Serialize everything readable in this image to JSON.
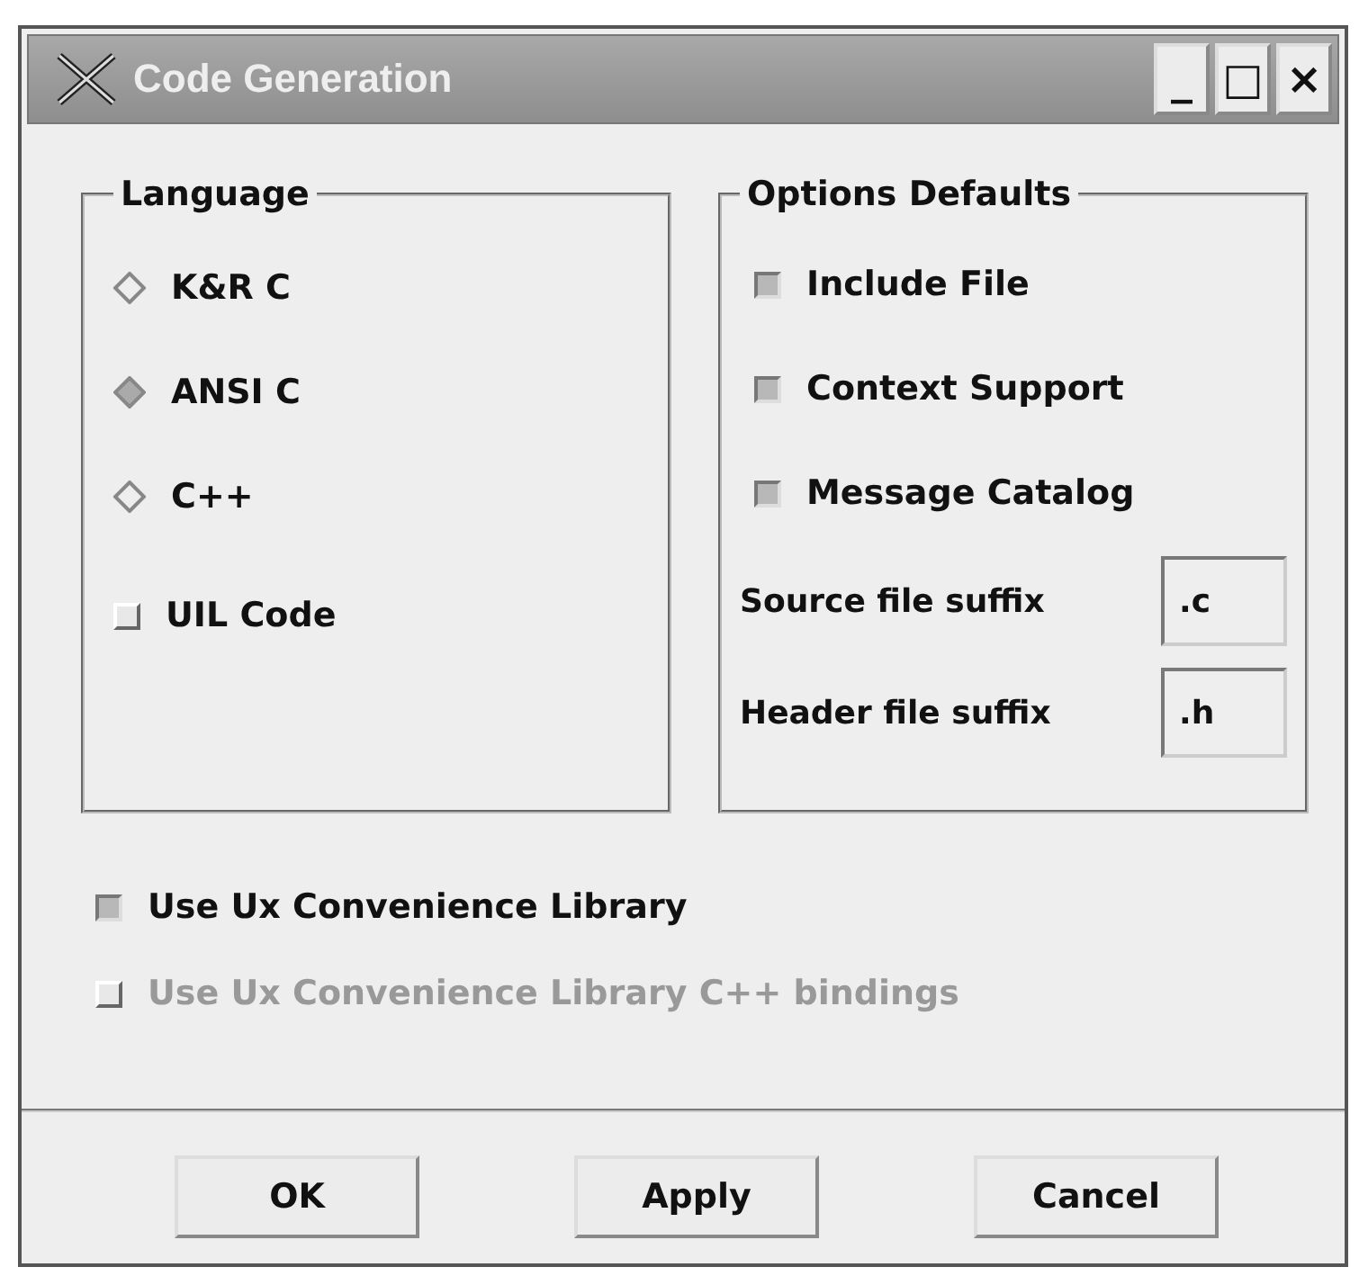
{
  "window": {
    "title": "Code Generation",
    "controls": [
      "_",
      "□",
      "×"
    ]
  },
  "language": {
    "title": "Language",
    "options": [
      {
        "label": "K&R C",
        "kind": "radio",
        "selected": false
      },
      {
        "label": "ANSI C",
        "kind": "radio",
        "selected": true
      },
      {
        "label": "C++",
        "kind": "radio",
        "selected": false
      },
      {
        "label": "UIL Code",
        "kind": "checkbox",
        "checked": false
      }
    ]
  },
  "options_defaults": {
    "title": "Options Defaults",
    "checkboxes": [
      {
        "label": "Include File",
        "checked": true
      },
      {
        "label": "Context Support",
        "checked": true
      },
      {
        "label": "Message Catalog",
        "checked": true
      }
    ],
    "fields": [
      {
        "label": "Source file suffix",
        "value": ".c"
      },
      {
        "label": "Header file suffix",
        "value": ".h"
      }
    ]
  },
  "library_options": [
    {
      "label": "Use Ux Convenience Library",
      "checked": true,
      "disabled": false
    },
    {
      "label": "Use Ux Convenience Library C++ bindings",
      "checked": false,
      "disabled": true
    }
  ],
  "buttons": [
    "OK",
    "Apply",
    "Cancel"
  ]
}
